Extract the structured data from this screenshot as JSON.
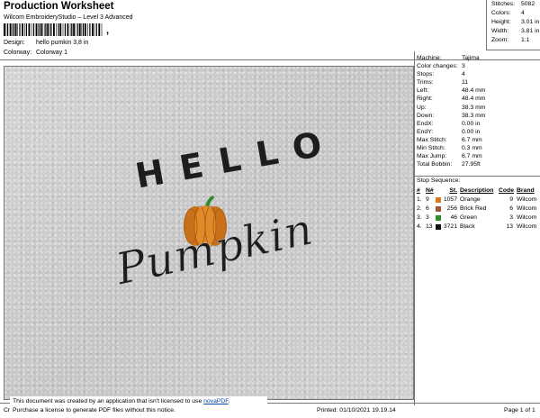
{
  "header": {
    "title": "Production Worksheet",
    "subtitle": "Wilcom EmbroideryStudio – Level 3 Advanced",
    "barcode_suffix": ",",
    "design_label": "Design:",
    "design_value": "hello pumkin 3,8 in",
    "colorway_label": "Colorway:",
    "colorway_value": "Colorway 1"
  },
  "summary": [
    {
      "k": "Stitches:",
      "v": "5082"
    },
    {
      "k": "Colors:",
      "v": "4"
    },
    {
      "k": "Height:",
      "v": "3.01 in"
    },
    {
      "k": "Width:",
      "v": "3.81 in"
    },
    {
      "k": "Zoom:",
      "v": "1:1"
    }
  ],
  "artwork": {
    "hello": "HELLO",
    "pumpkin": "Pumpkin"
  },
  "details": [
    {
      "k": "Machine:",
      "v": "Tajima"
    },
    {
      "k": "Color changes:",
      "v": "3"
    },
    {
      "k": "Stops:",
      "v": "4"
    },
    {
      "k": "Trims:",
      "v": "11"
    },
    {
      "k": "Left:",
      "v": "48.4 mm"
    },
    {
      "k": "Right:",
      "v": "48.4 mm"
    },
    {
      "k": "Up:",
      "v": "38.3 mm"
    },
    {
      "k": "Down:",
      "v": "38.3 mm"
    },
    {
      "k": "EndX:",
      "v": "0.00 in"
    },
    {
      "k": "EndY:",
      "v": "0.00 in"
    },
    {
      "k": "Max Stitch:",
      "v": "6.7 mm"
    },
    {
      "k": "Min Stitch:",
      "v": "0.3 mm"
    },
    {
      "k": "Max Jump:",
      "v": "6.7 mm"
    },
    {
      "k": "Total Bobbin:",
      "v": "27.95ft"
    }
  ],
  "stop_sequence": {
    "title": "Stop Sequence:",
    "headers": {
      "num": "#",
      "n": "N#",
      "st": "St.",
      "desc": "Description",
      "code": "Code",
      "brand": "Brand"
    },
    "rows": [
      {
        "num": "1.",
        "n": "9",
        "color": "#d97a1c",
        "st": "1057",
        "desc": "Orange",
        "code": "9",
        "brand": "Wilcom"
      },
      {
        "num": "2.",
        "n": "6",
        "color": "#9a5a3a",
        "st": "256",
        "desc": "Brick Red",
        "code": "6",
        "brand": "Wilcom"
      },
      {
        "num": "3.",
        "n": "3",
        "color": "#2f8f2f",
        "st": "46",
        "desc": "Green",
        "code": "3",
        "brand": "Wilcom"
      },
      {
        "num": "4.",
        "n": "13",
        "color": "#111111",
        "st": "3721",
        "desc": "Black",
        "code": "13",
        "brand": "Wilcom"
      }
    ]
  },
  "footer": {
    "cr": "Cr",
    "printed": "Printed: 01/10/2021 19.19.14",
    "page": "Page 1 of 1"
  },
  "notice": {
    "line1": "This document was created by an application that isn't licensed to use",
    "link": "novaPDF",
    "line1_end": ".",
    "line2": "Purchase a license to generate PDF files without this notice."
  }
}
